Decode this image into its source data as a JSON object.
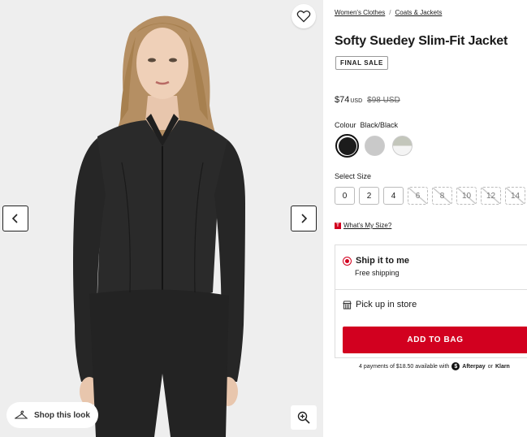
{
  "gallery": {
    "wishlist_icon": "heart-icon",
    "prev_icon": "chevron-left-icon",
    "next_icon": "chevron-right-icon",
    "shop_look_label": "Shop this look",
    "shop_look_icon": "hanger-icon",
    "zoom_icon": "zoom-in-icon"
  },
  "breadcrumb": [
    "Women's Clothes",
    "/",
    "Coats & Jackets"
  ],
  "product": {
    "title": "Softy Suedey Slim-Fit Jacket",
    "badge": "FINAL SALE",
    "price": "$74",
    "currency": "USD",
    "was_price": "$98 USD"
  },
  "colour": {
    "label": "Colour",
    "selected": "Black/Black",
    "swatches": [
      {
        "name": "Black/Black",
        "color": "#1c1c1c",
        "selected": true
      },
      {
        "name": "Grey",
        "color": "#c9c9c9",
        "selected": false
      },
      {
        "name": "Sage/White",
        "color": "#c3c6bb",
        "selected": false
      }
    ]
  },
  "size": {
    "label": "Select Size",
    "options": [
      {
        "label": "0",
        "available": true
      },
      {
        "label": "2",
        "available": true
      },
      {
        "label": "4",
        "available": true
      },
      {
        "label": "6",
        "available": false
      },
      {
        "label": "8",
        "available": false
      },
      {
        "label": "10",
        "available": false
      },
      {
        "label": "12",
        "available": false
      },
      {
        "label": "14",
        "available": false
      }
    ],
    "help_link": "What's My Size?",
    "help_badge": "T"
  },
  "delivery": {
    "ship_label": "Ship it to me",
    "ship_sub": "Free shipping",
    "pickup_label": "Pick up in store",
    "pickup_icon": "store-icon"
  },
  "cta": {
    "add_to_bag": "ADD TO BAG"
  },
  "payments": {
    "text": "4 payments of $18.50 available with",
    "afterpay": "Afterpay",
    "or": "or",
    "klarna": "Klarn"
  },
  "colors": {
    "accent": "#d2001f",
    "gallery_bg": "#eeeeee"
  }
}
